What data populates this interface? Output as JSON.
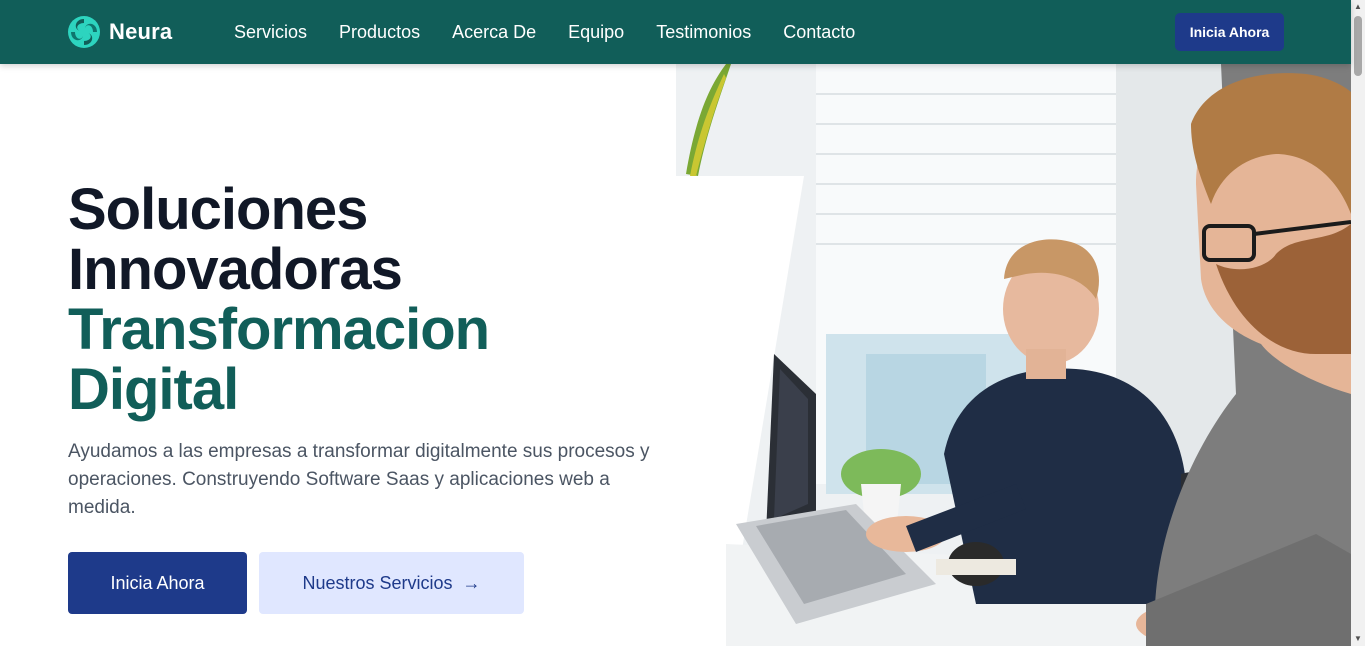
{
  "brand": {
    "name": "Neura",
    "logo_icon": "teal-swirl-logo-icon"
  },
  "nav": {
    "links": [
      "Servicios",
      "Productos",
      "Acerca De",
      "Equipo",
      "Testimonios",
      "Contacto"
    ],
    "cta_label": "Inicia Ahora"
  },
  "hero": {
    "title_line1": "Soluciones",
    "title_line2": "Innovadoras",
    "title_line3": "Transformacion",
    "title_line4": "Digital",
    "description": "Ayudamos a las empresas a transformar digitalmente sus procesos y operaciones. Construyendo Software Saas y aplicaciones web a medida.",
    "primary_button": "Inicia Ahora",
    "secondary_button": "Nuestros Servicios",
    "secondary_icon": "arrow-right-icon",
    "image_alt": "people-working-on-laptops-photo"
  },
  "colors": {
    "navbar": "#115e59",
    "brand_blue": "#1e3a8a",
    "light_blue": "#e0e7ff",
    "heading_dark": "#111827",
    "heading_green": "#115e59"
  }
}
